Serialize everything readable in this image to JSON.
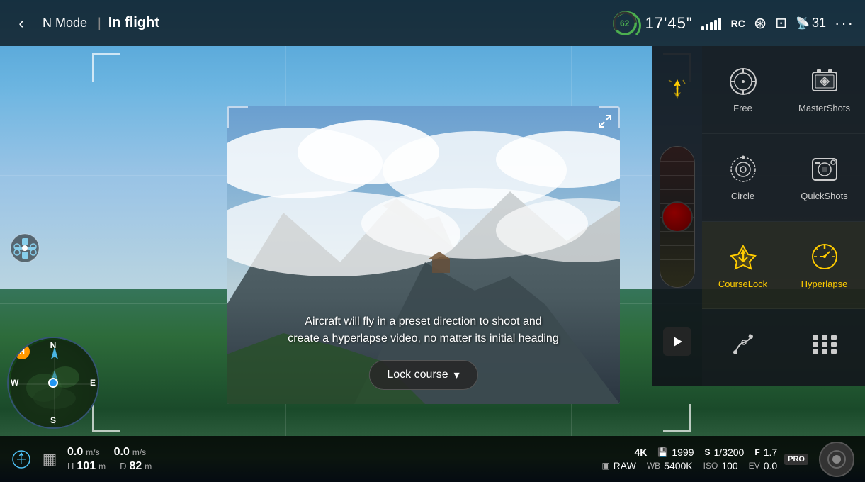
{
  "header": {
    "back_btn": "‹",
    "mode": "N Mode",
    "divider": "|",
    "status": "In flight",
    "battery_pct": "62",
    "flight_time": "17'45\"",
    "signal_label": "RC",
    "satellite_count": "31",
    "more_label": "···"
  },
  "compass": {
    "N": "N",
    "S": "S",
    "E": "E",
    "W": "W",
    "home_label": "H"
  },
  "flight_metrics": {
    "speed1_label": "",
    "speed1_value": "0.0",
    "speed1_unit": "m/s",
    "speed2_value": "0.0",
    "speed2_unit": "m/s",
    "h_label": "H",
    "h_value": "101",
    "h_unit": "m",
    "d_label": "D",
    "d_value": "82",
    "d_unit": "m"
  },
  "camera_settings": {
    "resolution": "4K",
    "storage_icon": "💾",
    "storage_value": "1999",
    "shutter_label": "S",
    "shutter_value": "1/3200",
    "aperture_label": "F",
    "aperture_value": "1.7",
    "format_label": "RAW",
    "wb_label": "WB",
    "wb_value": "5400K",
    "iso_label": "ISO",
    "iso_value": "100",
    "ev_label": "EV",
    "ev_value": "0.0",
    "pro_label": "PRO"
  },
  "modes": [
    {
      "id": "free",
      "label": "Free",
      "icon": "⊙",
      "active": false
    },
    {
      "id": "mastershots",
      "label": "MasterShots",
      "icon": "🎬",
      "active": false
    },
    {
      "id": "circle",
      "label": "Circle",
      "icon": "◎",
      "active": false
    },
    {
      "id": "quickshots",
      "label": "QuickShots",
      "icon": "🎞",
      "active": false
    },
    {
      "id": "courselock",
      "label": "CourseLock",
      "icon": "✦",
      "active": true
    },
    {
      "id": "hyperlapse",
      "label": "Hyperlapse",
      "icon": "⏱",
      "active": true
    },
    {
      "id": "waypoint",
      "label": "",
      "icon": "⤴",
      "active": false
    },
    {
      "id": "panorama",
      "label": "",
      "icon": "▦",
      "active": false
    }
  ],
  "video": {
    "subtitle": "Aircraft will fly in a preset direction to shoot and\ncreate a hyperlapse video, no matter its initial heading",
    "lock_course_label": "Lock course",
    "expand_icon": "⤡"
  }
}
